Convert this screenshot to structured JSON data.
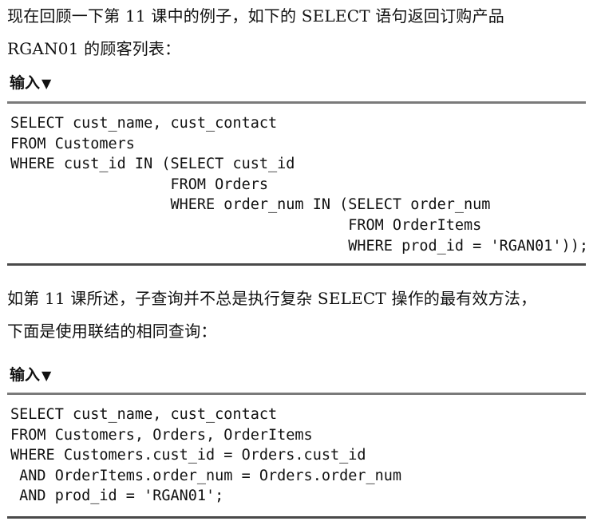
{
  "intro": {
    "lines": [
      "现在回顾一下第  11  课中的例子，如下的  SELECT  语句返回订购产品",
      "RGAN01 的顾客列表："
    ]
  },
  "input_label_1": "输入",
  "input_label_2": "输入",
  "label_marker": "▼",
  "code_1": [
    "SELECT cust_name, cust_contact",
    "FROM Customers",
    "WHERE cust_id IN (SELECT cust_id",
    "                  FROM Orders",
    "                  WHERE order_num IN (SELECT order_num",
    "                                      FROM OrderItems",
    "                                      WHERE prod_id = 'RGAN01'));"
  ],
  "middle": {
    "lines": [
      "如第 11 课所述，子查询并不总是执行复杂 SELECT 操作的最有效方法，",
      "下面是使用联结的相同查询："
    ]
  },
  "code_2": [
    "SELECT cust_name, cust_contact",
    "FROM Customers, Orders, OrderItems",
    "WHERE Customers.cust_id = Orders.cust_id",
    " AND OrderItems.order_num = Orders.order_num",
    " AND prod_id = 'RGAN01';"
  ]
}
